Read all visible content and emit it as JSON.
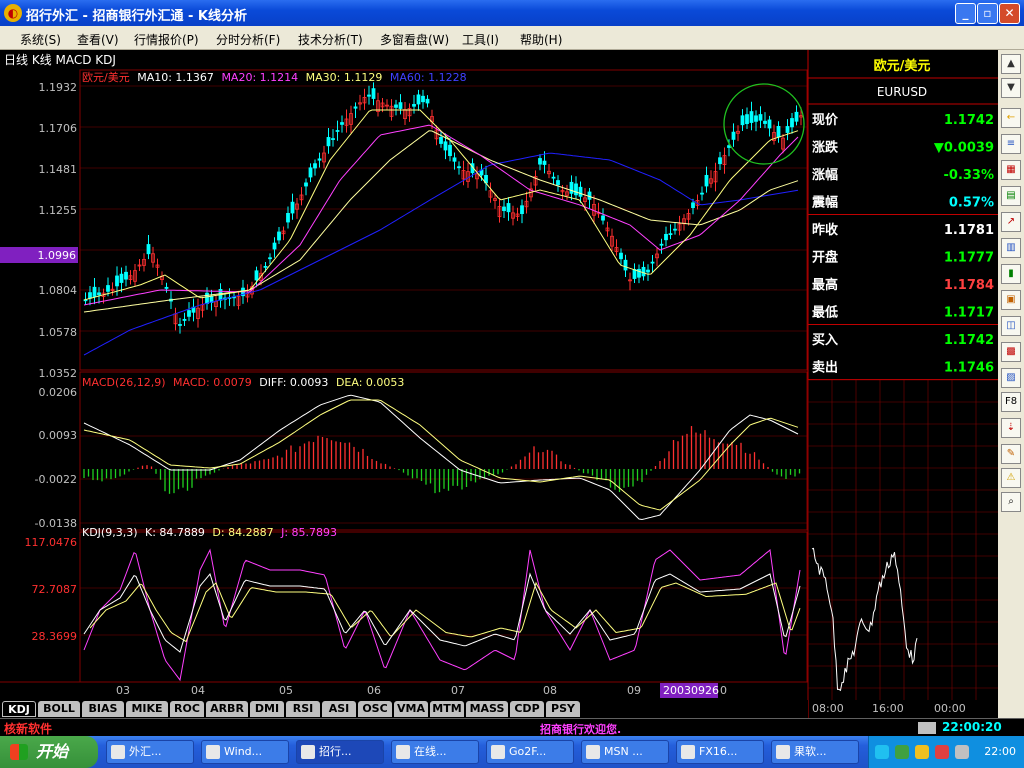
{
  "window": {
    "title": "招行外汇 - 招商银行外汇通 - K线分析",
    "minimize": "_",
    "maximize": "▫",
    "close": "✕"
  },
  "menu": [
    "系统(S)",
    "查看(V)",
    "行情报价(P)",
    "分时分析(F)",
    "技术分析(T)",
    "多窗看盘(W)",
    "工具(I)",
    "帮助(H)"
  ],
  "chart_header": "日线 K线 MACD KDJ",
  "main_panel": {
    "legend": {
      "symbol": "欧元/美元",
      "ma10": "MA10: 1.1367",
      "ma20": "MA20: 1.1214",
      "ma30": "MA30: 1.1129",
      "ma60": "MA60: 1.1228"
    },
    "y_ticks": [
      "1.1932",
      "1.1706",
      "1.1481",
      "1.1255",
      "1.1029",
      "1.0804",
      "1.0578",
      "1.0352"
    ],
    "cursor_price": "1.0996"
  },
  "macd_panel": {
    "legend": {
      "name": "MACD(26,12,9)",
      "macd": "MACD: 0.0079",
      "diff": "DIFF: 0.0093",
      "dea": "DEA: 0.0053"
    },
    "y_ticks": [
      "0.0206",
      "0.0093",
      "-0.0022",
      "-0.0138"
    ]
  },
  "kdj_panel": {
    "legend": {
      "name": "KDJ(9,3,3)",
      "k": "K: 84.7889",
      "d": "D: 84.2887",
      "j": "J: 85.7893"
    },
    "y_ticks": [
      "117.0476",
      "72.7087",
      "28.3699"
    ]
  },
  "x_axis": {
    "months": [
      "03",
      "04",
      "05",
      "06",
      "07",
      "08",
      "09",
      "0"
    ],
    "cursor_date": "20030926"
  },
  "quote": {
    "name": "欧元/美元",
    "code": "EURUSD",
    "rows": [
      {
        "label": "现价",
        "value": "1.1742",
        "color": "#00ff00"
      },
      {
        "label": "涨跌",
        "value": "▼0.0039",
        "color": "#00ff00"
      },
      {
        "label": "涨幅",
        "value": "-0.33%",
        "color": "#00ff00"
      },
      {
        "label": "震幅",
        "value": "0.57%",
        "color": "#00ffff"
      },
      {
        "label": "昨收",
        "value": "1.1781",
        "color": "#ffffff"
      },
      {
        "label": "开盘",
        "value": "1.1777",
        "color": "#00ff00"
      },
      {
        "label": "最高",
        "value": "1.1784",
        "color": "#ff4040"
      },
      {
        "label": "最低",
        "value": "1.1717",
        "color": "#00ff00"
      },
      {
        "label": "买入",
        "value": "1.1742",
        "color": "#00ff00"
      },
      {
        "label": "卖出",
        "value": "1.1746",
        "color": "#00ff00"
      }
    ]
  },
  "mini_chart": {
    "times": [
      "08:00",
      "16:00",
      "00:00"
    ]
  },
  "tabs": [
    "KDJ",
    "BOLL",
    "BIAS",
    "MIKE",
    "ROC",
    "ARBR",
    "DMI",
    "RSI",
    "ASI",
    "OSC",
    "VMA",
    "MTM",
    "MASS",
    "CDP",
    "PSY"
  ],
  "status": {
    "left": "核新软件",
    "center": "招商银行欢迎您.",
    "time": "22:00:20"
  },
  "taskbar": {
    "start": "开始",
    "tasks": [
      "外汇...",
      "Wind...",
      "招行...",
      "在线...",
      "Go2F...",
      "MSN ...",
      "FX16...",
      "果软..."
    ],
    "clock": "22:00"
  },
  "colors": {
    "up": "#ff3030",
    "down": "#00ffff",
    "ma10": "#ffff80",
    "ma20": "#ff40ff",
    "ma30": "#ffffa0",
    "ma60": "#2020ff",
    "grid": "#800000"
  },
  "chart_data": [
    {
      "type": "candlestick",
      "title": "欧元/美元",
      "ylim": [
        1.0352,
        1.1932
      ],
      "x": [
        "03",
        "04",
        "05",
        "06",
        "07",
        "08",
        "09",
        "20030926"
      ],
      "series": [
        {
          "name": "MA10",
          "values": [
            1.082,
            1.085,
            1.094,
            1.178,
            1.165,
            1.143,
            1.092,
            1.1367
          ]
        },
        {
          "name": "MA20",
          "values": [
            1.08,
            1.079,
            1.083,
            1.163,
            1.17,
            1.145,
            1.115,
            1.1214
          ]
        },
        {
          "name": "MA30",
          "values": [
            1.076,
            1.078,
            1.082,
            1.15,
            1.168,
            1.15,
            1.12,
            1.1129
          ]
        },
        {
          "name": "MA60",
          "values": [
            1.052,
            1.075,
            1.08,
            1.11,
            1.15,
            1.148,
            1.134,
            1.1228
          ]
        }
      ]
    },
    {
      "type": "bar",
      "title": "MACD(26,12,9)",
      "ylim": [
        -0.0138,
        0.0206
      ],
      "series": [
        {
          "name": "DIFF",
          "values": [
            0.0093,
            0.001,
            -0.002,
            0.019,
            0.012,
            0.001,
            -0.013,
            0.0093
          ]
        },
        {
          "name": "DEA",
          "values": [
            0.008,
            0.002,
            -0.0015,
            0.017,
            0.014,
            0.002,
            -0.011,
            0.0053
          ]
        }
      ]
    },
    {
      "type": "line",
      "title": "KDJ(9,3,3)",
      "ylim": [
        0,
        117.0476
      ],
      "series": [
        {
          "name": "K",
          "values": [
            60,
            35,
            75,
            55,
            40,
            80,
            20,
            84.7889
          ]
        },
        {
          "name": "D",
          "values": [
            55,
            40,
            70,
            58,
            45,
            75,
            25,
            84.2887
          ]
        },
        {
          "name": "J",
          "values": [
            75,
            20,
            110,
            45,
            30,
            100,
            5,
            85.7893
          ]
        }
      ]
    }
  ]
}
